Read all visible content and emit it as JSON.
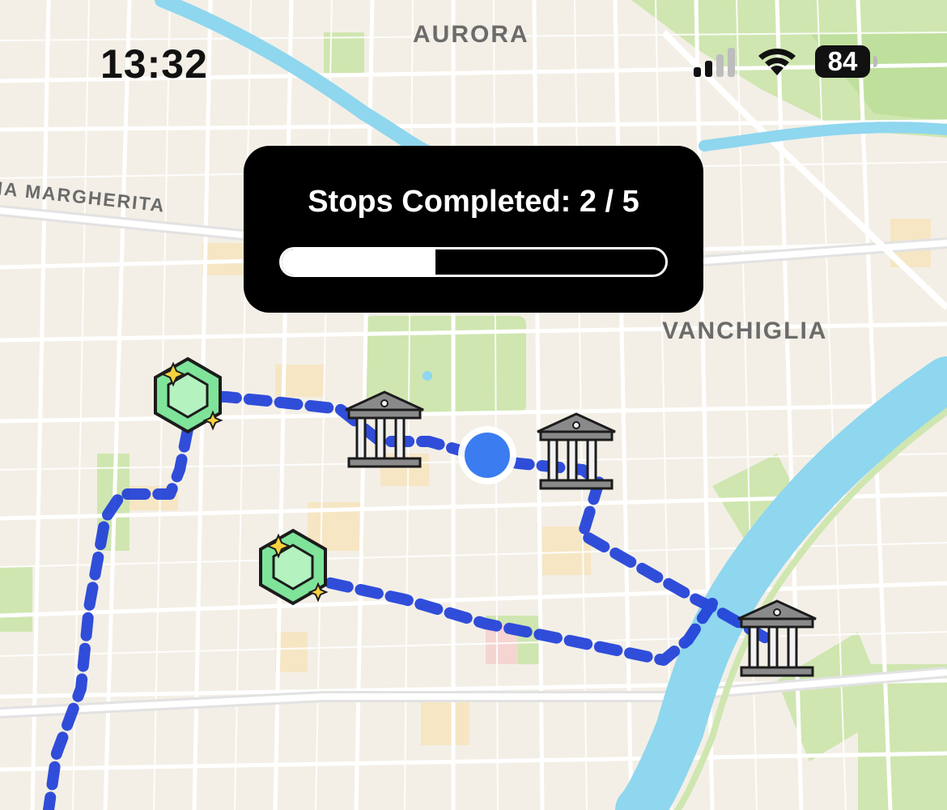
{
  "status_bar": {
    "time": "13:32",
    "battery": "84",
    "icons": [
      "cellular-signal-icon",
      "wifi-icon",
      "battery-icon"
    ]
  },
  "map": {
    "area_labels": {
      "aurora": "AURORA",
      "vanchiglia": "VANCHIGLIA",
      "margherita": "NA MARGHERITA"
    },
    "markers": [
      "gem-icon",
      "gem-icon",
      "museum-icon",
      "museum-icon",
      "museum-icon",
      "current-location-icon"
    ],
    "route_color": "#1f3fd8"
  },
  "progress": {
    "label": "Stops Completed: 2 / 5",
    "completed": 2,
    "total": 5,
    "fraction": 0.4
  },
  "colors": {
    "map_land": "#f3efe6",
    "park": "#cfe6b0",
    "river": "#8fd6ef",
    "route": "#1f3fd8",
    "location_dot": "#3b7cf0",
    "card": "#000000"
  }
}
